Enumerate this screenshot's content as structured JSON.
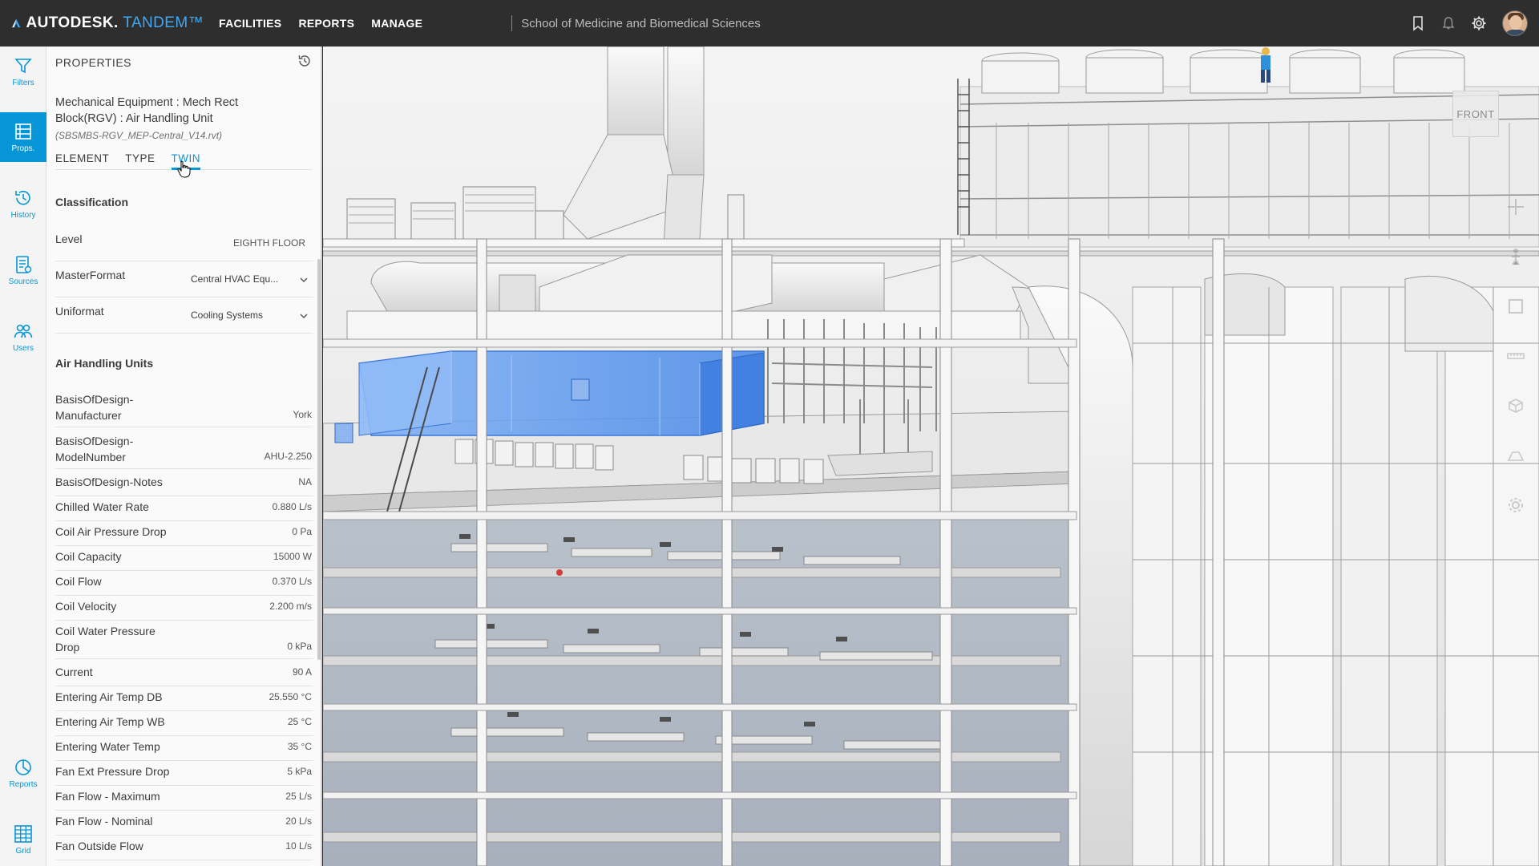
{
  "app": {
    "brand": "AUTODESK.",
    "product": "TANDEM™",
    "nav": [
      "FACILITIES",
      "REPORTS",
      "MANAGE"
    ],
    "facility": "School of Medicine and Biomedical Sciences"
  },
  "rail": {
    "items": [
      {
        "label": "Filters",
        "icon": "filter-icon"
      },
      {
        "label": "Props.",
        "icon": "properties-icon"
      },
      {
        "label": "History",
        "icon": "history-icon"
      },
      {
        "label": "Sources",
        "icon": "sources-icon"
      },
      {
        "label": "Users",
        "icon": "users-icon"
      },
      {
        "label": "Reports",
        "icon": "reports-icon"
      },
      {
        "label": "Grid",
        "icon": "grid-icon"
      }
    ]
  },
  "panel": {
    "title": "PROPERTIES",
    "element_name": "Mechanical Equipment : Mech Rect Block(RGV) : Air Handling Unit",
    "element_file": "(SBSMBS-RGV_MEP-Central_V14.rvt)",
    "tabs": [
      "ELEMENT",
      "TYPE",
      "TWIN"
    ],
    "active_tab": "TWIN",
    "classification": {
      "title": "Classification",
      "rows": [
        {
          "key": "Level",
          "value": "EIGHTH FLOOR"
        },
        {
          "key": "MasterFormat",
          "value": "Central HVAC Equ..."
        },
        {
          "key": "Uniformat",
          "value": "Cooling Systems"
        }
      ]
    },
    "ahu": {
      "title": "Air Handling Units",
      "rows": [
        {
          "key": "BasisOfDesign-Manufacturer",
          "value": "York"
        },
        {
          "key": "BasisOfDesign-ModelNumber",
          "value": "AHU-2.250"
        },
        {
          "key": "BasisOfDesign-Notes",
          "value": "NA"
        },
        {
          "key": "Chilled Water Rate",
          "value": "0.880 L/s"
        },
        {
          "key": "Coil Air Pressure Drop",
          "value": "0 Pa"
        },
        {
          "key": "Coil Capacity",
          "value": "15000 W"
        },
        {
          "key": "Coil Flow",
          "value": "0.370 L/s"
        },
        {
          "key": "Coil Velocity",
          "value": "2.200 m/s"
        },
        {
          "key": "Coil Water Pressure Drop",
          "value": "0 kPa"
        },
        {
          "key": "Current",
          "value": "90 A"
        },
        {
          "key": "Entering Air Temp DB",
          "value": "25.550 °C"
        },
        {
          "key": "Entering Air Temp WB",
          "value": "25 °C"
        },
        {
          "key": "Entering Water Temp",
          "value": "35 °C"
        },
        {
          "key": "Fan Ext Pressure Drop",
          "value": "5 kPa"
        },
        {
          "key": "Fan Flow - Maximum",
          "value": "25 L/s"
        },
        {
          "key": "Fan Flow - Nominal",
          "value": "20 L/s"
        },
        {
          "key": "Fan Outside Flow",
          "value": "10 L/s"
        }
      ]
    }
  },
  "viewport": {
    "view_cube_label": "FRONT"
  },
  "colors": {
    "accent": "#0696d7",
    "topbar": "#2e2e2e",
    "selection": "#4a90f0"
  }
}
